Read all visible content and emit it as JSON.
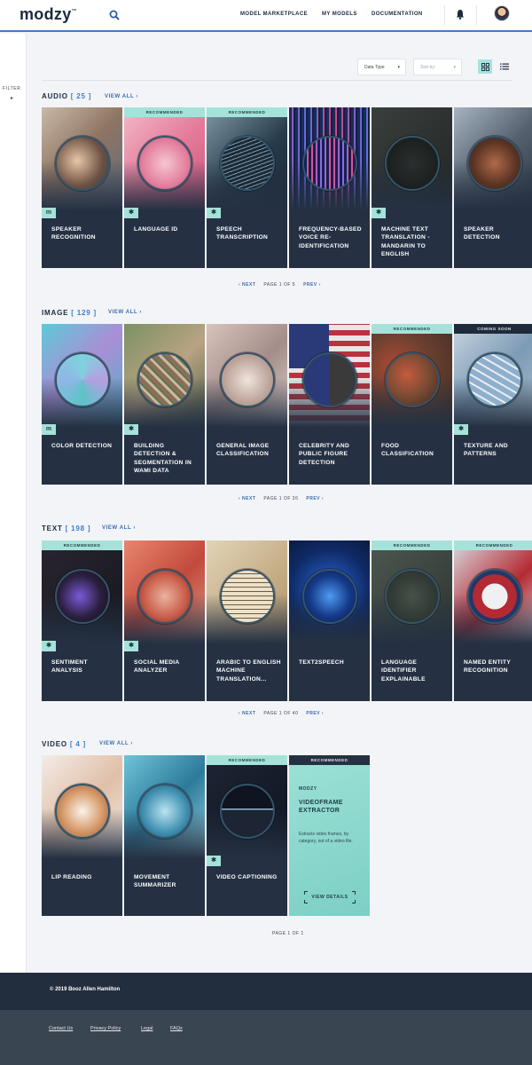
{
  "header": {
    "logo": "modzy",
    "logo_tm": "™",
    "nav": [
      "MODEL MARKETPLACE",
      "MY MODELS",
      "DOCUMENTATION"
    ]
  },
  "sidebar": {
    "filter_label": "FILTER",
    "arrow": "▸"
  },
  "controls": {
    "data_type": "Data Type",
    "sort_by": "Sort by:",
    "caret": "▾"
  },
  "colors": {
    "accent": "#3d7fc9",
    "mint": "#a5e3da",
    "card": "#253143",
    "footer": "#222e3e"
  },
  "sections": [
    {
      "title": "AUDIO",
      "count": "[ 25 ]",
      "view_all": "VIEW ALL ›",
      "pager": {
        "next": "‹  NEXT",
        "page": "PAGE 1 OF 5",
        "prev": "PREV  ›"
      },
      "cards": [
        {
          "name": "SPEAKER RECOGNITION",
          "badge": "",
          "tag": "m",
          "icon": "people-photo"
        },
        {
          "name": "LANGUAGE ID",
          "badge": "RECOMMENDED",
          "tag": "✱",
          "icon": "pink-keyboard"
        },
        {
          "name": "SPEECH TRANSCRIPTION",
          "badge": "RECOMMENDED",
          "tag": "✱",
          "icon": "soundwave"
        },
        {
          "name": "FREQUENCY-BASED VOICE RE-IDENTIFICATION",
          "badge": "",
          "tag": "",
          "icon": "frequency-bars"
        },
        {
          "name": "MACHINE TEXT TRANSLATION - MANDARIN TO ENGLISH",
          "badge": "",
          "tag": "✱",
          "icon": "chalkboard"
        },
        {
          "name": "SPEAKER DETECTION",
          "badge": "",
          "tag": "",
          "icon": "audio-device"
        }
      ]
    },
    {
      "title": "IMAGE",
      "count": "[ 129 ]",
      "view_all": "VIEW ALL ›",
      "pager": {
        "next": "‹  NEXT",
        "page": "PAGE 1 OF 26",
        "prev": "PREV  ›"
      },
      "cards": [
        {
          "name": "COLOR DETECTION",
          "badge": "",
          "tag": "m",
          "icon": "iridescent"
        },
        {
          "name": "BUILDING DETECTION & SEGMENTATION IN WAMI DATA",
          "badge": "",
          "tag": "✱",
          "icon": "aerial"
        },
        {
          "name": "GENERAL IMAGE CLASSIFICATION",
          "badge": "",
          "tag": "",
          "icon": "collage"
        },
        {
          "name": "CELEBRITY AND PUBLIC FIGURE DETECTION",
          "badge": "",
          "tag": "",
          "icon": "flag"
        },
        {
          "name": "FOOD CLASSIFICATION",
          "badge": "RECOMMENDED",
          "tag": "",
          "icon": "food"
        },
        {
          "name": "TEXTURE AND PATTERNS",
          "badge": "COMING SOON",
          "tag": "✱",
          "icon": "tiles"
        }
      ]
    },
    {
      "title": "TEXT",
      "count": "[ 198 ]",
      "view_all": "VIEW ALL ›",
      "pager": {
        "next": "‹  NEXT",
        "page": "PAGE 1 OF 40",
        "prev": "PREV  ›"
      },
      "cards": [
        {
          "name": "SENTIMENT ANALYSIS",
          "badge": "RECOMMENDED",
          "tag": "✱",
          "icon": "phone-likes"
        },
        {
          "name": "SOCIAL MEDIA ANALYZER",
          "badge": "",
          "tag": "✱",
          "icon": "social-hands"
        },
        {
          "name": "ARABIC TO ENGLISH MACHINE TRANSLATION...",
          "badge": "",
          "tag": "",
          "icon": "manuscript"
        },
        {
          "name": "TEXT2SPEECH",
          "badge": "",
          "tag": "",
          "icon": "neon-speech"
        },
        {
          "name": "LANGUAGE IDENTIFIER EXPLAINABLE",
          "badge": "RECOMMENDED",
          "tag": "",
          "icon": "chalk-hello"
        },
        {
          "name": "NAMED ENTITY RECOGNITION",
          "badge": "RECOMMENDED",
          "tag": "",
          "icon": "name-tag"
        }
      ]
    },
    {
      "title": "VIDEO",
      "count": "[ 4 ]",
      "view_all": "VIEW ALL ›",
      "pager": {
        "page": "PAGE 1 OF 1"
      },
      "cards": [
        {
          "name": "LIP READING",
          "badge": "",
          "tag": "",
          "icon": "lips"
        },
        {
          "name": "MOVEMENT SUMMARIZER",
          "badge": "",
          "tag": "",
          "icon": "crowd"
        },
        {
          "name": "VIDEO CAPTIONING",
          "badge": "RECOMMENDED",
          "tag": "✱",
          "icon": "video-timeline"
        }
      ],
      "feature": {
        "badge": "RECOMMENDED",
        "brand": "MODZY",
        "title": "VIDEOFRAME EXTRACTOR",
        "description": "Extracts video frames, by category, out of a video file.",
        "button": "VIEW DETAILS"
      }
    }
  ],
  "footer": {
    "copyright": "© 2019 Booz Allen Hamilton",
    "links": [
      "Contact Us",
      "Privacy Policy",
      "Legal",
      "FAQs"
    ]
  }
}
